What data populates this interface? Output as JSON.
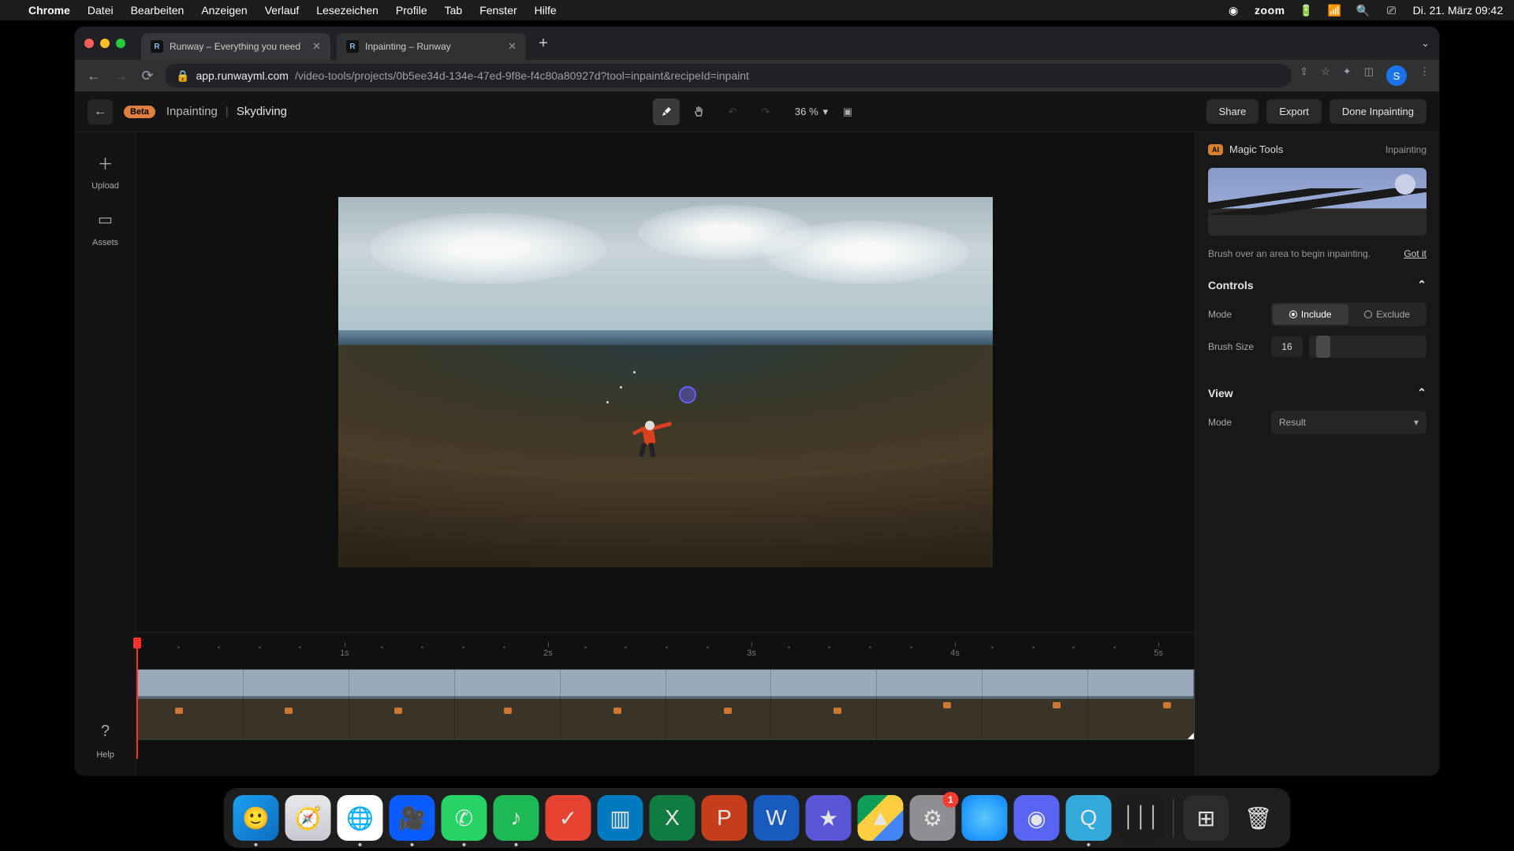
{
  "os_menubar": {
    "app": "Chrome",
    "menus": [
      "Datei",
      "Bearbeiten",
      "Anzeigen",
      "Verlauf",
      "Lesezeichen",
      "Profile",
      "Tab",
      "Fenster",
      "Hilfe"
    ],
    "zoom": "zoom",
    "clock": "Di. 21. März  09:42"
  },
  "browser": {
    "tabs": [
      {
        "title": "Runway – Everything you need",
        "active": false
      },
      {
        "title": "Inpainting – Runway",
        "active": true
      }
    ],
    "url_host": "app.runwayml.com",
    "url_path": "/video-tools/projects/0b5ee34d-134e-47ed-9f8e-f4c80a80927d?tool=inpaint&recipeId=inpaint",
    "avatar_initial": "S"
  },
  "app": {
    "beta_label": "Beta",
    "tool_name": "Inpainting",
    "project_name": "Skydiving",
    "zoom": "36 %",
    "buttons": {
      "share": "Share",
      "export": "Export",
      "done": "Done Inpainting"
    },
    "sidebar": {
      "upload": "Upload",
      "assets": "Assets",
      "help": "Help"
    },
    "right_panel": {
      "magic_tools": "Magic Tools",
      "mode_name": "Inpainting",
      "hint": "Brush over an area to begin inpainting.",
      "got_it": "Got it",
      "controls_header": "Controls",
      "mode_label": "Mode",
      "include": "Include",
      "exclude": "Exclude",
      "brush_label": "Brush Size",
      "brush_value": "16",
      "view_header": "View",
      "view_mode_label": "Mode",
      "view_mode_value": "Result"
    },
    "timeline": {
      "marks": [
        "1s",
        "2s",
        "3s",
        "4s",
        "5s"
      ]
    }
  },
  "dock": {
    "apps": [
      {
        "name": "finder",
        "bg": "linear-gradient(135deg,#1ba1f2,#0d6bbf)",
        "glyph": "🙂",
        "running": true
      },
      {
        "name": "safari",
        "bg": "linear-gradient(180deg,#e8e8ec,#c8c8d0)",
        "glyph": "🧭",
        "running": false
      },
      {
        "name": "chrome",
        "bg": "#fff",
        "glyph": "🌐",
        "running": true
      },
      {
        "name": "zoom",
        "bg": "#0b5cff",
        "glyph": "🎥",
        "running": true
      },
      {
        "name": "whatsapp",
        "bg": "#25d366",
        "glyph": "✆",
        "running": true
      },
      {
        "name": "spotify",
        "bg": "#1db954",
        "glyph": "♪",
        "running": true
      },
      {
        "name": "todoist",
        "bg": "#e44332",
        "glyph": "✓",
        "running": false
      },
      {
        "name": "trello",
        "bg": "#0079bf",
        "glyph": "▥",
        "running": false
      },
      {
        "name": "excel",
        "bg": "#107c41",
        "glyph": "X",
        "running": false
      },
      {
        "name": "powerpoint",
        "bg": "#c43e1c",
        "glyph": "P",
        "running": false
      },
      {
        "name": "word",
        "bg": "#185abd",
        "glyph": "W",
        "running": false
      },
      {
        "name": "imovie",
        "bg": "#5856d6",
        "glyph": "★",
        "running": false
      },
      {
        "name": "drive",
        "bg": "linear-gradient(135deg,#0f9d58 33%,#ffcd40 33% 66%,#4285f4 66%)",
        "glyph": "▲",
        "running": false
      },
      {
        "name": "settings",
        "bg": "#8e8e93",
        "glyph": "⚙",
        "running": false,
        "badge": "1"
      },
      {
        "name": "app-blue",
        "bg": "radial-gradient(circle,#5ac8fa,#0a84ff)",
        "glyph": "",
        "running": false
      },
      {
        "name": "discord",
        "bg": "#5865f2",
        "glyph": "◉",
        "running": false
      },
      {
        "name": "quicktime",
        "bg": "#34aadc",
        "glyph": "Q",
        "running": true
      },
      {
        "name": "voice-memos",
        "bg": "#1c1c1e",
        "glyph": "⏐⏐⏐",
        "running": false
      }
    ],
    "secondary": [
      {
        "name": "calculator",
        "bg": "#2c2c2e",
        "glyph": "⊞"
      },
      {
        "name": "trash",
        "bg": "transparent",
        "glyph": "🗑"
      }
    ]
  }
}
